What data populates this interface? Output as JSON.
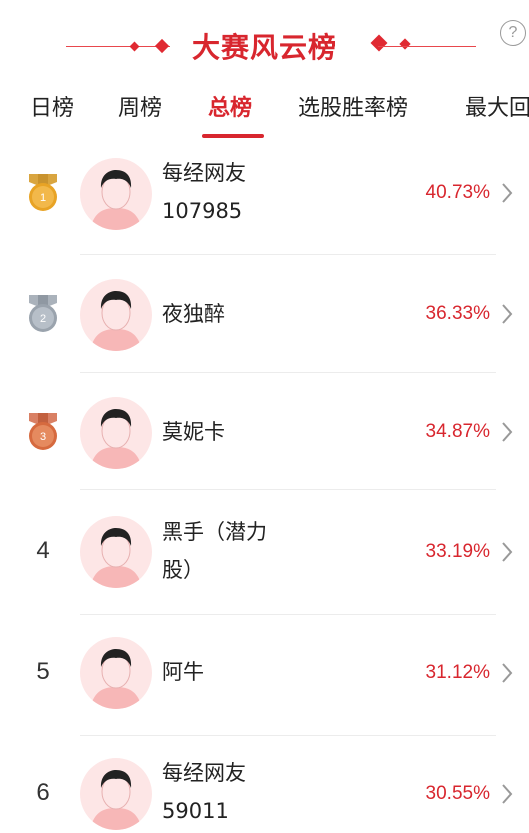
{
  "header": {
    "title": "大赛风云榜",
    "help_icon": "?"
  },
  "tabs": [
    {
      "label": "日榜",
      "active": false
    },
    {
      "label": "周榜",
      "active": false
    },
    {
      "label": "总榜",
      "active": true
    },
    {
      "label": "选股胜率榜",
      "active": false
    },
    {
      "label": "最大回",
      "active": false
    }
  ],
  "list": [
    {
      "rank": "1",
      "medal": "gold",
      "name": "每经网友107985",
      "rate": "40.73%"
    },
    {
      "rank": "2",
      "medal": "silver",
      "name": "夜独醉",
      "rate": "36.33%"
    },
    {
      "rank": "3",
      "medal": "bronze",
      "name": "莫妮卡",
      "rate": "34.87%"
    },
    {
      "rank": "4",
      "medal": "",
      "name": "黑手（潜力股）",
      "rate": "33.19%"
    },
    {
      "rank": "5",
      "medal": "",
      "name": "阿牛",
      "rate": "31.12%"
    },
    {
      "rank": "6",
      "medal": "",
      "name": "每经网友59011",
      "rate": "30.55%"
    }
  ],
  "colors": {
    "accent": "#d8262e",
    "gold": "#e8a325",
    "silver": "#9aa3ad",
    "bronze": "#d66a3f"
  }
}
